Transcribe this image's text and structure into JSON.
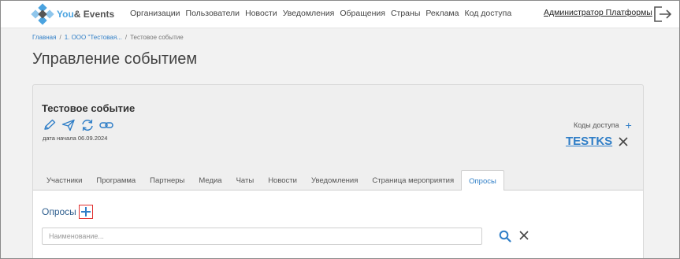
{
  "brand": {
    "you": "You",
    "rest": "& Events"
  },
  "nav": [
    "Организации",
    "Пользователи",
    "Новости",
    "Уведомления",
    "Обращения",
    "Страны",
    "Реклама",
    "Код доступа"
  ],
  "user": {
    "name": "Администратор Платформы"
  },
  "breadcrumb": {
    "home": "Главная",
    "sep": "/",
    "org": "1. ООО \"Тестовая...",
    "current": "Тестовое событие"
  },
  "page": {
    "title": "Управление событием"
  },
  "event": {
    "title": "Тестовое событие",
    "start_label": "дата начала",
    "start_date": "06.09.2024",
    "actions": [
      "pencil-icon",
      "send-icon",
      "refresh-icon",
      "link-icon"
    ]
  },
  "access_codes": {
    "title": "Коды доступа",
    "add": "+",
    "codes": [
      "TESTKS"
    ]
  },
  "tabs": [
    {
      "label": "Участники",
      "active": false
    },
    {
      "label": "Программа",
      "active": false
    },
    {
      "label": "Партнеры",
      "active": false
    },
    {
      "label": "Медиа",
      "active": false
    },
    {
      "label": "Чаты",
      "active": false
    },
    {
      "label": "Новости",
      "active": false
    },
    {
      "label": "Уведомления",
      "active": false
    },
    {
      "label": "Страница мероприятия",
      "active": false
    },
    {
      "label": "Опросы",
      "active": true
    }
  ],
  "polls": {
    "title": "Опросы",
    "search_placeholder": "Наименование...",
    "search_value": ""
  },
  "colors": {
    "accent": "#2f7ec7",
    "highlight": "#e03030"
  }
}
